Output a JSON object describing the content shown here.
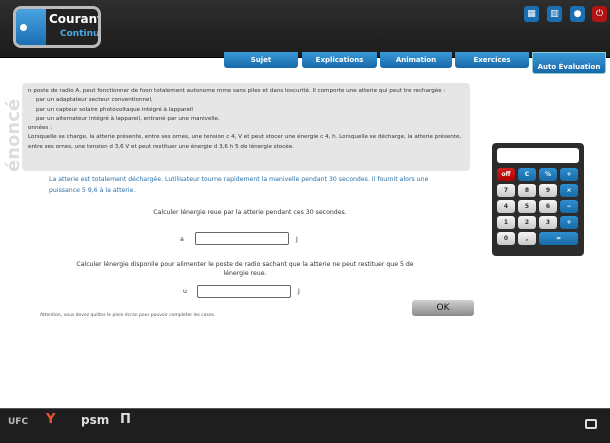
{
  "header": {
    "logo_title": "Courant",
    "logo_subtitle": "Continu",
    "icons": [
      "calculator-icon",
      "book-icon",
      "user-icon",
      "power-icon"
    ]
  },
  "tabs": [
    {
      "label": "Sujet"
    },
    {
      "label": "Explications"
    },
    {
      "label": "Animation"
    },
    {
      "label": "Exercices"
    },
    {
      "label": "Auto Évaluation",
      "active": true
    }
  ],
  "enonce": {
    "label": "énoncé",
    "lines": [
      "n poste de radio A, peut fonctionner de foon totalement autonome mme sans piles et dans loscurité. Il comporte une atterie qui peut tre rechargée :",
      "par un adaptateur secteur conventionnel,",
      "par un capteur solaire photovoltaque intégré à lappareil",
      "par un alternateur intégré à lappareil, entrané par une manivelle.",
      "onnées :",
      "Lorsquelle se charge, la atterie présente, entre ses ornes, une tension c  4, V et peut stocer une énergie c  4, h. Lorsquelle se décharge, la atterie présente, entre ses ornes, une tension d  3,6 V et peut restituer une énergie d  3,6 h 5 de lénergie stocée."
    ]
  },
  "intro": "La atterie est totalement déchargée. Lutilisateur tourne rapidement la manivelle pendant 30 secondes. Il fournit alors une puissance 5  9,6  à la atterie.",
  "q1": {
    "text": "Calculer lénergie reue par la atterie pendant ces 30 secondes.",
    "prefix": "a",
    "value": "",
    "unit": "J"
  },
  "q2": {
    "text": "Calculer lénergie disponile pour alimenter le poste de radio sachant que la atterie ne peut restituer que 5 de lénergie reue.",
    "prefix": "u",
    "value": "",
    "unit": "J"
  },
  "ok_label": "OK",
  "note": "Attention, vous devez quitter le plein écran pour pouvoir completer les cases.",
  "calculator": {
    "display": "",
    "keys": [
      "off",
      "C",
      "%",
      "+",
      "7",
      "8",
      "9",
      "×",
      "4",
      "5",
      "6",
      "−",
      "1",
      "2",
      "3",
      "+",
      "0",
      ",",
      "="
    ]
  },
  "footer": {
    "logos": [
      "UFC",
      "Y",
      "psm",
      "Π"
    ]
  }
}
